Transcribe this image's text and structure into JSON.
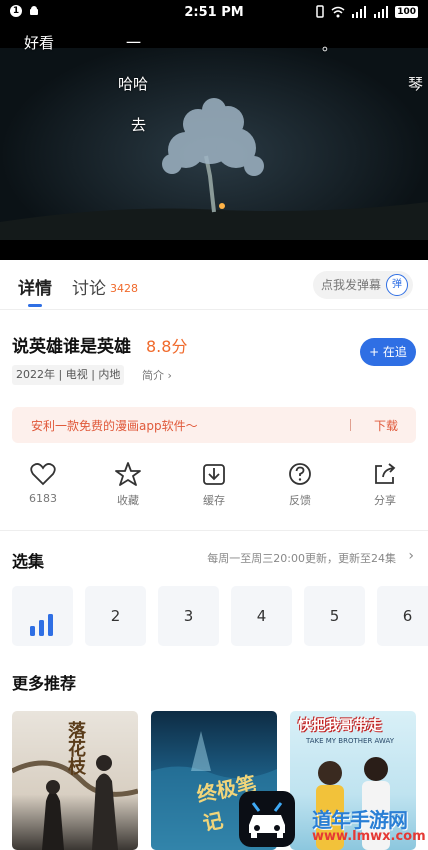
{
  "status_bar": {
    "time": "2:51 PM",
    "notification_count": "1",
    "battery": "100"
  },
  "video": {
    "danmaku": [
      {
        "text": "好看"
      },
      {
        "text": "一"
      },
      {
        "text": "。"
      },
      {
        "text": "哈哈"
      },
      {
        "text": "琴"
      },
      {
        "text": "去"
      }
    ]
  },
  "tabs": {
    "detail_label": "详情",
    "discuss_label": "讨论",
    "discuss_count": "3428",
    "danmaku_placeholder": "点我发弹幕",
    "danmaku_toggle": "弹"
  },
  "show": {
    "title": "说英雄谁是英雄",
    "score": "8.8分",
    "follow_label": "+ 在追",
    "meta": "2022年 | 电视 | 内地",
    "intro_label": "简介 ›"
  },
  "promo": {
    "text": "安利一款免费的漫画app软件〜",
    "download_label": "下载",
    "divider": "|"
  },
  "actions": [
    {
      "icon": "heart-icon",
      "label": "6183"
    },
    {
      "icon": "star-icon",
      "label": "收藏"
    },
    {
      "icon": "download-icon",
      "label": "缓存"
    },
    {
      "icon": "question-icon",
      "label": "反馈"
    },
    {
      "icon": "share-icon",
      "label": "分享"
    }
  ],
  "episodes": {
    "title": "选集",
    "update_info": "每周一至周三20:00更新，更新至24集",
    "items": [
      "2",
      "3",
      "4",
      "5",
      "6"
    ]
  },
  "recommend": {
    "title": "更多推荐",
    "posters": [
      {
        "title": "落花枝"
      },
      {
        "title": "终极笔记"
      },
      {
        "title": "快把我哥带走",
        "subtitle": "TAKE MY BROTHER AWAY"
      }
    ]
  },
  "watermark": {
    "text": "道年手游网",
    "url": "www.lmwx.com"
  },
  "colors": {
    "accent": "#2f6fe4",
    "score": "#f06a2c",
    "promo": "#e0593a"
  }
}
